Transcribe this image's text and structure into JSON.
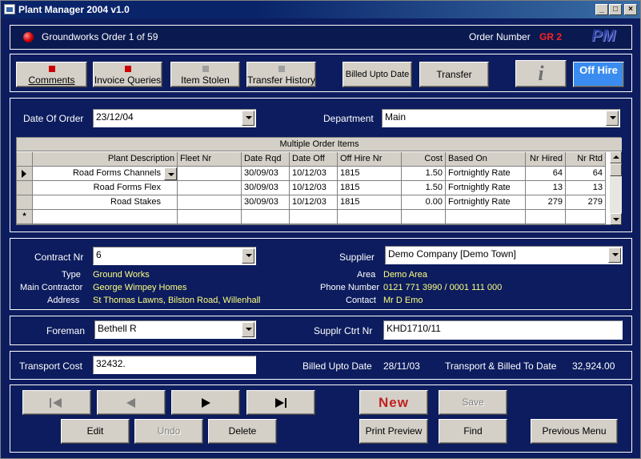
{
  "window": {
    "title": "Plant Manager 2004 v1.0",
    "min": "_",
    "max": "□",
    "close": "×"
  },
  "header": {
    "record": "Groundworks Order 1 of 59",
    "order_number_label": "Order Number",
    "order_number": "GR 2",
    "logo": "PM"
  },
  "toolbar": {
    "comments": "Comments",
    "invoice_queries": "Invoice Queries",
    "item_stolen": "Item Stolen",
    "transfer_history": "Transfer History",
    "billed_upto_date": "Billed Upto Date",
    "transfer": "Transfer",
    "info": "i",
    "off_hire": "Off Hire"
  },
  "order": {
    "date_label": "Date Of Order",
    "date_value": "23/12/04",
    "department_label": "Department",
    "department_value": "Main"
  },
  "items": {
    "caption": "Multiple Order Items",
    "columns": [
      "Plant Description",
      "Fleet Nr",
      "Date Rqd",
      "Date Off",
      "Off Hire Nr",
      "Cost",
      "Based On",
      "Nr Hired",
      "Nr Rtd"
    ],
    "rows": [
      [
        "Road Forms Channels",
        "",
        "30/09/03",
        "10/12/03",
        "1815",
        "1.50",
        "Fortnightly Rate",
        "64",
        "64"
      ],
      [
        "Road Forms Flex",
        "",
        "30/09/03",
        "10/12/03",
        "1815",
        "1.50",
        "Fortnightly Rate",
        "13",
        "13"
      ],
      [
        "Road Stakes",
        "",
        "30/09/03",
        "10/12/03",
        "1815",
        "0.00",
        "Fortnightly Rate",
        "279",
        "279"
      ]
    ],
    "new_row_marker": "*"
  },
  "contract": {
    "contract_label": "Contract Nr",
    "contract_value": "6",
    "type_label": "Type",
    "type_value": "Ground Works",
    "main_contractor_label": "Main Contractor",
    "main_contractor_value": "George Wimpey Homes",
    "address_label": "Address",
    "address_value": "St Thomas Lawns, Bilston Road, Willenhall",
    "supplier_label": "Supplier",
    "supplier_value": "Demo Company [Demo Town]",
    "area_label": "Area",
    "area_value": "Demo Area",
    "phone_label": "Phone Number",
    "phone_value": "0121 771 3990 / 0001 111 000",
    "contact_label": "Contact",
    "contact_value": "Mr D Emo"
  },
  "foreman": {
    "label": "Foreman",
    "value": "Bethell R",
    "supplr_label": "Supplr Ctrt Nr",
    "supplr_value": "KHD1710/11"
  },
  "transport": {
    "cost_label": "Transport Cost",
    "cost_value": "32432.",
    "billed_label": "Billed Upto Date",
    "billed_value": "28/11/03",
    "total_label": "Transport & Billed To Date",
    "total_value": "32,924.00"
  },
  "nav": {
    "new": "New",
    "save": "Save",
    "edit": "Edit",
    "undo": "Undo",
    "delete": "Delete",
    "print_preview": "Print Preview",
    "find": "Find",
    "previous_menu": "Previous Menu"
  },
  "colors": {
    "accent_red": "#cc0000",
    "background": "#0c1c5e",
    "value_yellow": "#ffff80",
    "off_hire_blue": "#3a8cf0"
  }
}
